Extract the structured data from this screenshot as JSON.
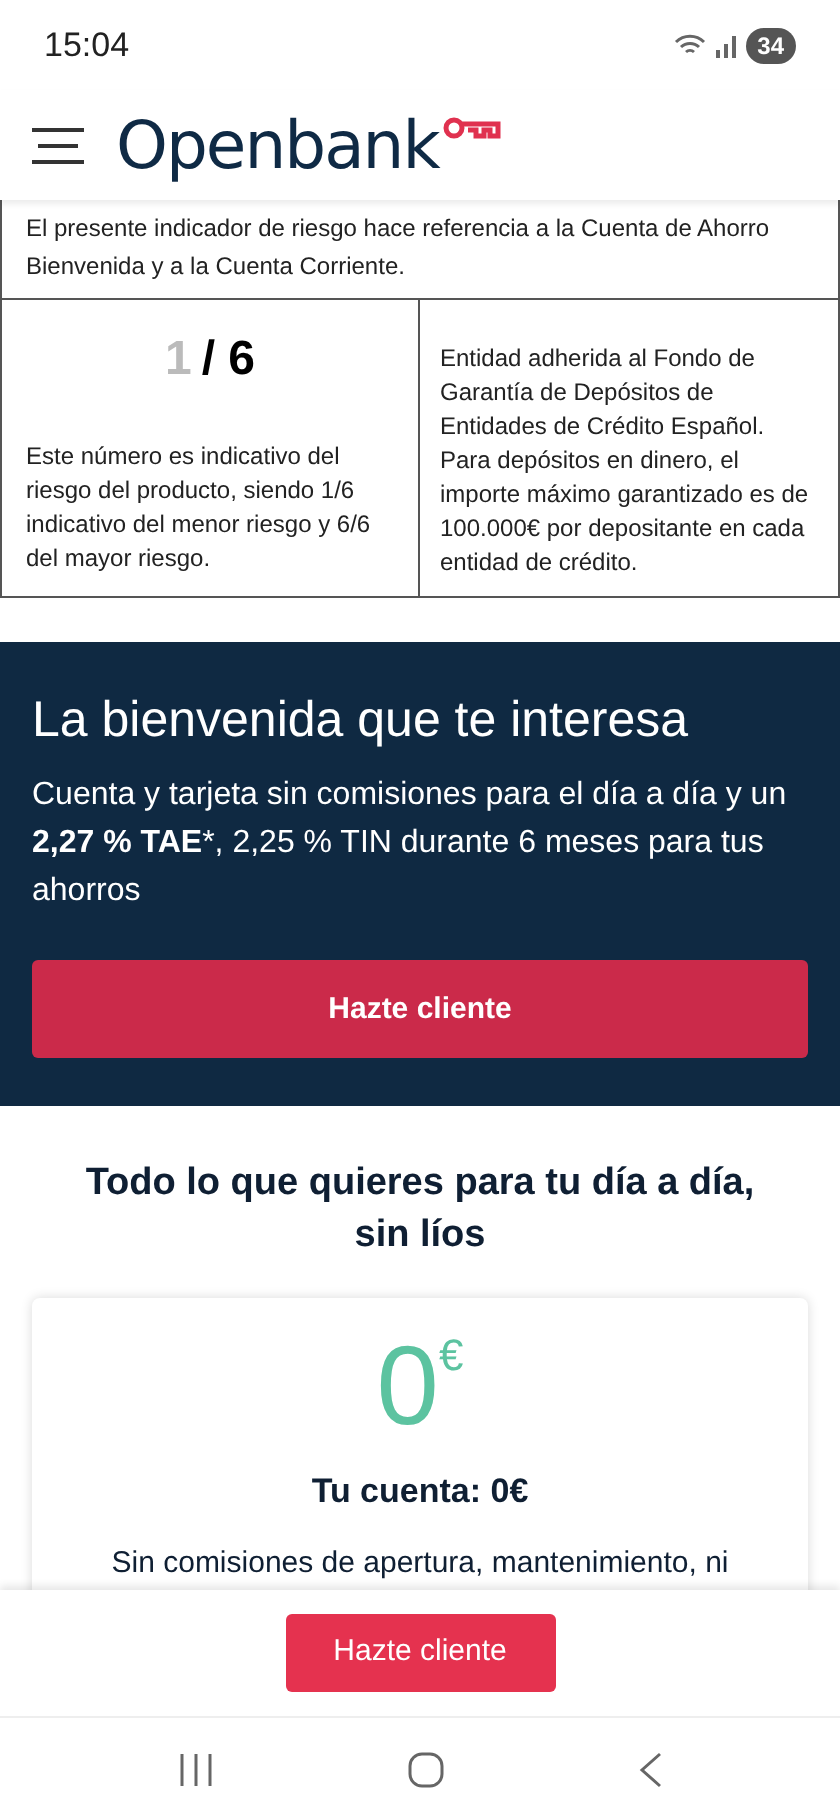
{
  "status_bar": {
    "time": "15:04",
    "battery": "34"
  },
  "header": {
    "logo": "Openbank"
  },
  "risk_box": {
    "note": "El presente indicador de riesgo hace referencia a la Cuenta de Ahorro Bienvenida y a la Cuenta Corriente.",
    "risk_value": "1",
    "risk_scale": "/ 6",
    "risk_explanation": "Este número es indicativo del riesgo del producto, siendo 1/6 indicativo del menor riesgo y 6/6 del mayor riesgo.",
    "guarantee": "Entidad adherida al Fondo de Garantía de Depósitos de Entidades de Crédito Español. Para depósitos en dinero, el importe máximo garantizado es de 100.000€ por depositante en cada entidad de crédito."
  },
  "hero": {
    "title": "La bienvenida que te interesa",
    "text": "Cuenta y tarjeta sin comisiones para el día a día y un\n**2,27 % TAE***, 2,25 % TIN durante 6 meses para tus ahorros",
    "button": "Hazte cliente"
  },
  "features": {
    "title": "Todo lo que quieres para tu día a día, sin líos",
    "card": {
      "amount": "0",
      "currency": "€",
      "title": "Tu cuenta: 0€",
      "text": "Sin comisiones de apertura, mantenimiento, ni"
    }
  },
  "sticky_button": "Hazte cliente"
}
